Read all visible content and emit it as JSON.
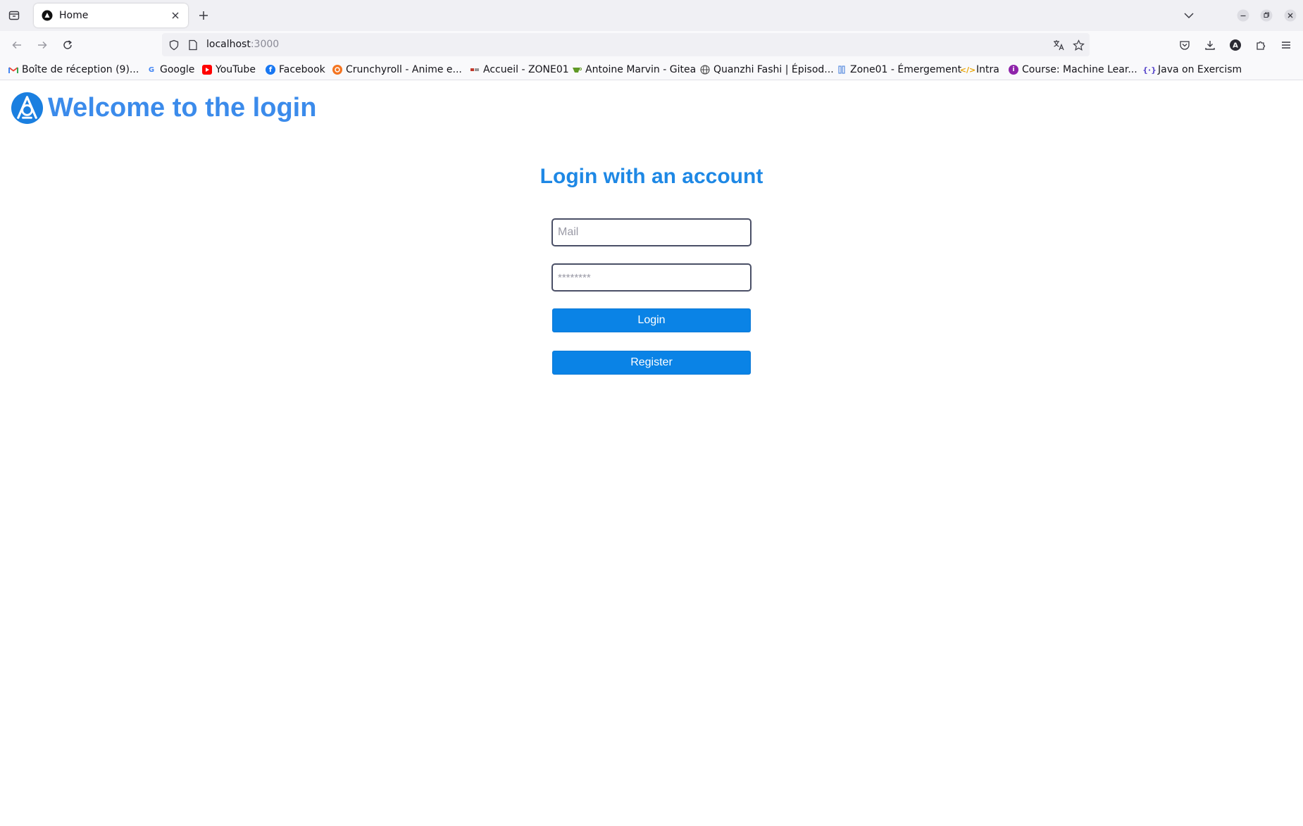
{
  "browser": {
    "tab": {
      "title": "Home",
      "favicon": "triangle-logo-icon"
    },
    "url": {
      "host": "localhost",
      "port": ":3000"
    },
    "bookmarks": [
      {
        "label": "Boîte de réception (9)...",
        "icon": "gmail-icon",
        "color": "#ea4335"
      },
      {
        "label": "Google",
        "icon": "google-icon",
        "color": "#4285f4"
      },
      {
        "label": "YouTube",
        "icon": "youtube-icon",
        "color": "#ff0000"
      },
      {
        "label": "Facebook",
        "icon": "facebook-icon",
        "color": "#1877f2"
      },
      {
        "label": "Crunchyroll - Anime e...",
        "icon": "crunchyroll-icon",
        "color": "#f47521"
      },
      {
        "label": "Accueil - ZONE01",
        "icon": "zone01-icon",
        "color": "#888888"
      },
      {
        "label": "Antoine Marvin - Gitea",
        "icon": "gitea-icon",
        "color": "#609926"
      },
      {
        "label": "Quanzhi Fashi | Épisod...",
        "icon": "globe-icon",
        "color": "#444444"
      },
      {
        "label": "Zone01 - Émergement",
        "icon": "zone01-emergement-icon",
        "color": "#5a8ee0"
      },
      {
        "label": "Intra",
        "icon": "code-icon",
        "color": "#e8a200"
      },
      {
        "label": "Course: Machine Lear...",
        "icon": "course-icon",
        "color": "#8e24aa"
      },
      {
        "label": "Java on Exercism",
        "icon": "exercism-icon",
        "color": "#604fcd"
      }
    ]
  },
  "page": {
    "brand_title": "Welcome to the login",
    "login_title": "Login with an account",
    "mail_placeholder": "Mail",
    "password_placeholder": "********",
    "login_label": "Login",
    "register_label": "Register"
  },
  "colors": {
    "brand": "#3b8beb",
    "heading": "#1e88e5",
    "button": "#0a83e6"
  }
}
